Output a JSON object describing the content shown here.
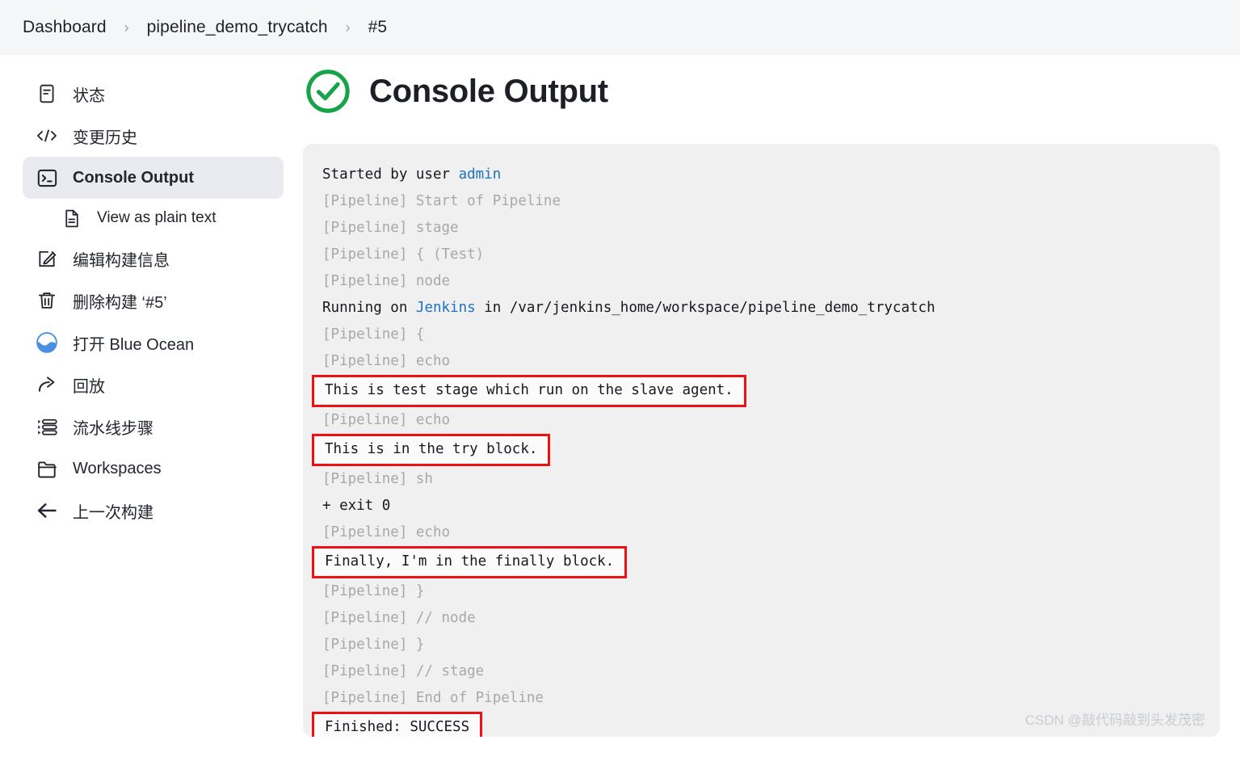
{
  "breadcrumb": {
    "items": [
      {
        "label": "Dashboard"
      },
      {
        "label": "pipeline_demo_trycatch"
      },
      {
        "label": "#5"
      }
    ],
    "separator": "›"
  },
  "sidebar": {
    "items": [
      {
        "label": "状态",
        "icon": "status-document-icon",
        "active": false,
        "sub": false
      },
      {
        "label": "变更历史",
        "icon": "code-brackets-icon",
        "active": false,
        "sub": false
      },
      {
        "label": "Console Output",
        "icon": "terminal-icon",
        "active": true,
        "sub": false
      },
      {
        "label": "View as plain text",
        "icon": "plain-text-file-icon",
        "active": false,
        "sub": true
      },
      {
        "label": "编辑构建信息",
        "icon": "edit-pencil-icon",
        "active": false,
        "sub": false
      },
      {
        "label": "删除构建 ‘#5’",
        "icon": "trash-icon",
        "active": false,
        "sub": false
      },
      {
        "label": "打开 Blue Ocean",
        "icon": "blue-ocean-icon",
        "active": false,
        "sub": false
      },
      {
        "label": "回放",
        "icon": "replay-arrow-icon",
        "active": false,
        "sub": false
      },
      {
        "label": "流水线步骤",
        "icon": "pipeline-steps-icon",
        "active": false,
        "sub": false
      },
      {
        "label": "Workspaces",
        "icon": "folder-icon",
        "active": false,
        "sub": false
      },
      {
        "label": "上一次构建",
        "icon": "back-arrow-icon",
        "active": false,
        "sub": false
      }
    ]
  },
  "main": {
    "status_icon": "success-check-circle-icon",
    "title": "Console Output",
    "accent_success": "#16a34a",
    "annotation_color": "#ee1111",
    "link_color": "#1a73c7"
  },
  "console": {
    "lines": [
      {
        "id": "l1",
        "type": "output",
        "boxed": false,
        "segments": [
          {
            "text": "Started by user "
          },
          {
            "text": "admin",
            "link": true
          }
        ]
      },
      {
        "id": "l2",
        "type": "pipeline",
        "boxed": false,
        "text": "[Pipeline] Start of Pipeline"
      },
      {
        "id": "l3",
        "type": "pipeline",
        "boxed": false,
        "text": "[Pipeline] stage"
      },
      {
        "id": "l4",
        "type": "pipeline",
        "boxed": false,
        "text": "[Pipeline] { (Test)"
      },
      {
        "id": "l5",
        "type": "pipeline",
        "boxed": false,
        "text": "[Pipeline] node"
      },
      {
        "id": "l6",
        "type": "output",
        "boxed": false,
        "segments": [
          {
            "text": "Running on "
          },
          {
            "text": "Jenkins",
            "link": true
          },
          {
            "text": " in /var/jenkins_home/workspace/pipeline_demo_trycatch"
          }
        ]
      },
      {
        "id": "l7",
        "type": "pipeline",
        "boxed": false,
        "text": "[Pipeline] {"
      },
      {
        "id": "l8",
        "type": "pipeline",
        "boxed": false,
        "text": "[Pipeline] echo"
      },
      {
        "id": "l9",
        "type": "output",
        "boxed": true,
        "text": "This is test stage which run on the slave agent."
      },
      {
        "id": "l10",
        "type": "pipeline",
        "boxed": false,
        "text": "[Pipeline] echo"
      },
      {
        "id": "l11",
        "type": "output",
        "boxed": true,
        "text": "This is in the try block."
      },
      {
        "id": "l12",
        "type": "pipeline",
        "boxed": false,
        "text": "[Pipeline] sh"
      },
      {
        "id": "l13",
        "type": "output",
        "boxed": false,
        "text": "+ exit 0"
      },
      {
        "id": "l14",
        "type": "pipeline",
        "boxed": false,
        "text": "[Pipeline] echo"
      },
      {
        "id": "l15",
        "type": "output",
        "boxed": true,
        "text": "Finally, I'm in the finally block."
      },
      {
        "id": "l16",
        "type": "pipeline",
        "boxed": false,
        "text": "[Pipeline] }"
      },
      {
        "id": "l17",
        "type": "pipeline",
        "boxed": false,
        "text": "[Pipeline] // node"
      },
      {
        "id": "l18",
        "type": "pipeline",
        "boxed": false,
        "text": "[Pipeline] }"
      },
      {
        "id": "l19",
        "type": "pipeline",
        "boxed": false,
        "text": "[Pipeline] // stage"
      },
      {
        "id": "l20",
        "type": "pipeline",
        "boxed": false,
        "text": "[Pipeline] End of Pipeline"
      },
      {
        "id": "l21",
        "type": "output",
        "boxed": true,
        "text": "Finished: SUCCESS"
      }
    ]
  },
  "watermark": {
    "text": "CSDN @敲代码敲到头发茂密"
  }
}
